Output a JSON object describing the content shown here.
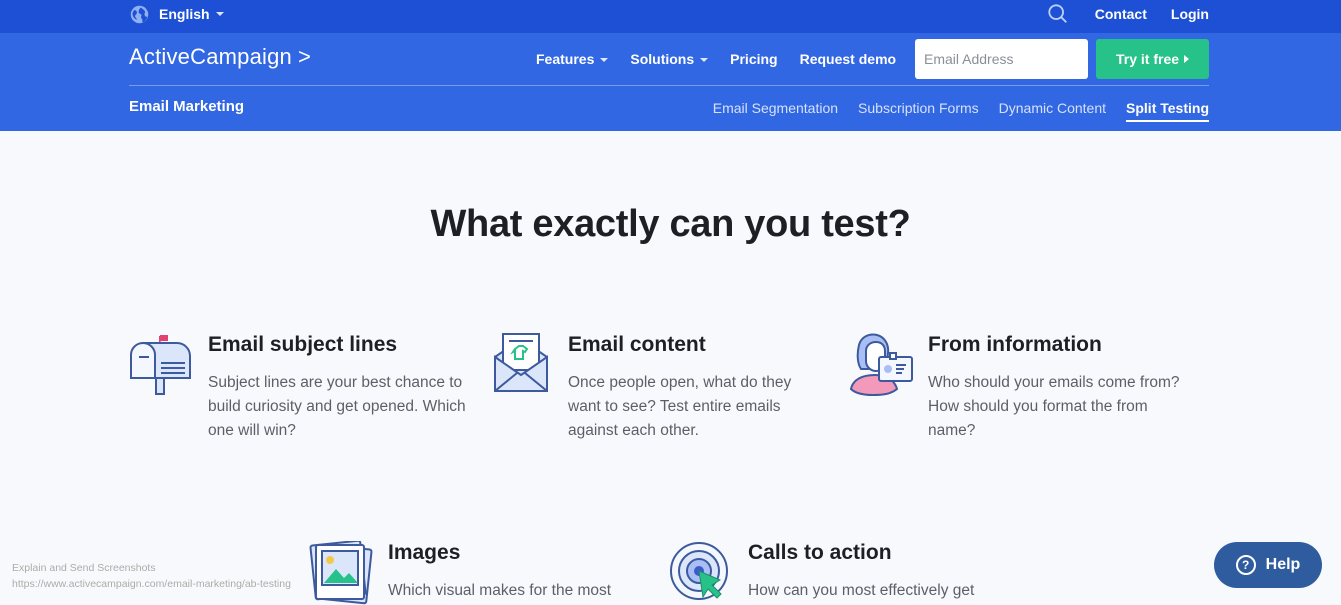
{
  "topbar": {
    "language": "English",
    "links": [
      "Contact",
      "Login"
    ]
  },
  "navbar": {
    "logo": "ActiveCampaign",
    "logo_chevron": ">",
    "nav_items": [
      {
        "label": "Features",
        "dropdown": true
      },
      {
        "label": "Solutions",
        "dropdown": true
      },
      {
        "label": "Pricing",
        "dropdown": false
      },
      {
        "label": "Request demo",
        "dropdown": false
      }
    ],
    "email_placeholder": "Email Address",
    "email_value": "",
    "cta_label": "Try it free",
    "cta_color": "#27c28a"
  },
  "subnav": {
    "title": "Email Marketing",
    "items": [
      {
        "label": "Email Segmentation",
        "active": false
      },
      {
        "label": "Subscription Forms",
        "active": false
      },
      {
        "label": "Dynamic Content",
        "active": false
      },
      {
        "label": "Split Testing",
        "active": true
      }
    ]
  },
  "main": {
    "heading": "What exactly can you test?",
    "features": [
      {
        "icon": "mailbox-icon",
        "title": "Email subject lines",
        "text": "Subject lines are your best chance to build curiosity and get opened. Which one will win?"
      },
      {
        "icon": "open-envelope-icon",
        "title": "Email content",
        "text": "Once people open, what do they want to see? Test entire emails against each other."
      },
      {
        "icon": "person-id-card-icon",
        "title": "From information",
        "text": "Who should your emails come from? How should you format the from name?"
      },
      {
        "icon": "image-stack-icon",
        "title": "Images",
        "text": "Which visual makes for the most"
      },
      {
        "icon": "target-cursor-icon",
        "title": "Calls to action",
        "text": "How can you most effectively get"
      }
    ]
  },
  "overlay": {
    "line1": "Explain and Send Screenshots",
    "line2": "https://www.activecampaign.com/email-marketing/ab-testing"
  },
  "help": {
    "label": "Help"
  },
  "colors": {
    "topbar": "#1d50d4",
    "navbar": "#3167e2",
    "help_button": "#2f5c9e"
  }
}
